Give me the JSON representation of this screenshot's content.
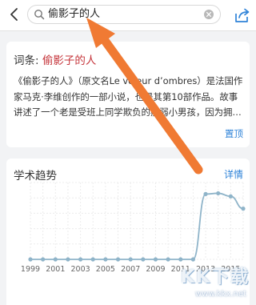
{
  "search": {
    "query": "偷影子的人"
  },
  "entry": {
    "prefix": "词条: ",
    "term": "偷影子的人",
    "description": "《偷影子的人》（原文名Le voleur d’ombres）是法国作家马克·李维创作的一部小说，也是其第10部作品。故事讲述了一个老是受班上同学欺负的瘦弱小男孩，因为拥…",
    "pin_label": "置顶"
  },
  "trend": {
    "title": "学术趋势",
    "detail_label": "详情"
  },
  "chart_data": {
    "type": "line",
    "x": [
      1999,
      2000,
      2001,
      2002,
      2003,
      2004,
      2005,
      2006,
      2007,
      2008,
      2009,
      2010,
      2011,
      2012,
      2013,
      2014,
      2015,
      2016
    ],
    "series": [
      {
        "values": [
          0,
          0,
          0,
          0,
          0,
          0,
          0,
          0,
          0,
          0,
          0,
          0,
          0,
          0,
          0.85,
          0.86,
          0.82,
          0.66
        ]
      }
    ],
    "tick_labels": [
      "1999",
      "2001",
      "2003",
      "2005",
      "2007",
      "2009",
      "2011",
      "2013",
      "2015"
    ],
    "grid": true,
    "line_color": "#8fb4c9"
  },
  "watermark": {
    "text": "KK下载",
    "url": "www.kkx.net"
  },
  "colors": {
    "accent": "#2f83d8",
    "term": "#c5343a",
    "arrow": "#f07a33"
  }
}
